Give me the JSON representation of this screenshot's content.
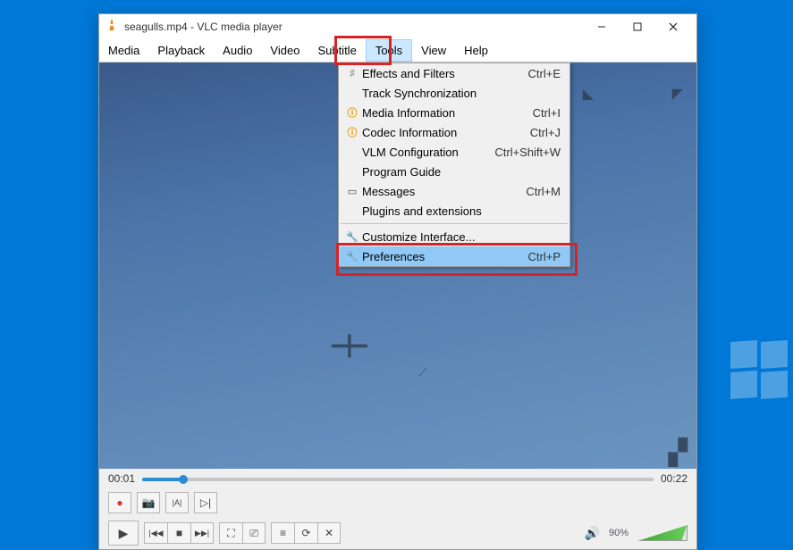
{
  "window": {
    "title": "seagulls.mp4 - VLC media player"
  },
  "menubar": [
    "Media",
    "Playback",
    "Audio",
    "Video",
    "Subtitle",
    "Tools",
    "View",
    "Help"
  ],
  "menubar_active_index": 5,
  "tools_menu": [
    {
      "icon": "sliders",
      "label": "Effects and Filters",
      "shortcut": "Ctrl+E"
    },
    {
      "icon": "",
      "label": "Track Synchronization",
      "shortcut": ""
    },
    {
      "icon": "info",
      "label": "Media Information",
      "shortcut": "Ctrl+I"
    },
    {
      "icon": "info",
      "label": "Codec Information",
      "shortcut": "Ctrl+J"
    },
    {
      "icon": "",
      "label": "VLM Configuration",
      "shortcut": "Ctrl+Shift+W"
    },
    {
      "icon": "",
      "label": "Program Guide",
      "shortcut": ""
    },
    {
      "icon": "msgs",
      "label": "Messages",
      "shortcut": "Ctrl+M"
    },
    {
      "icon": "",
      "label": "Plugins and extensions",
      "shortcut": ""
    },
    {
      "sep": true
    },
    {
      "icon": "wrench",
      "label": "Customize Interface...",
      "shortcut": ""
    },
    {
      "icon": "wrench",
      "label": "Preferences",
      "shortcut": "Ctrl+P",
      "hovered": true
    }
  ],
  "playback": {
    "current_time": "00:01",
    "total_time": "00:22",
    "seek_percent": 8
  },
  "volume": {
    "percent_label": "90%",
    "percent": 90
  },
  "icons": {
    "record": "●",
    "snapshot": "📷",
    "atob": "|A|",
    "frame": "▷|",
    "play": "▶",
    "prev": "|◀◀",
    "stop": "■",
    "next": "▶▶|",
    "fullscreen": "⛶",
    "ext": "⎚",
    "playlist": "≡",
    "loop": "⟳",
    "shuffle": "✕"
  }
}
